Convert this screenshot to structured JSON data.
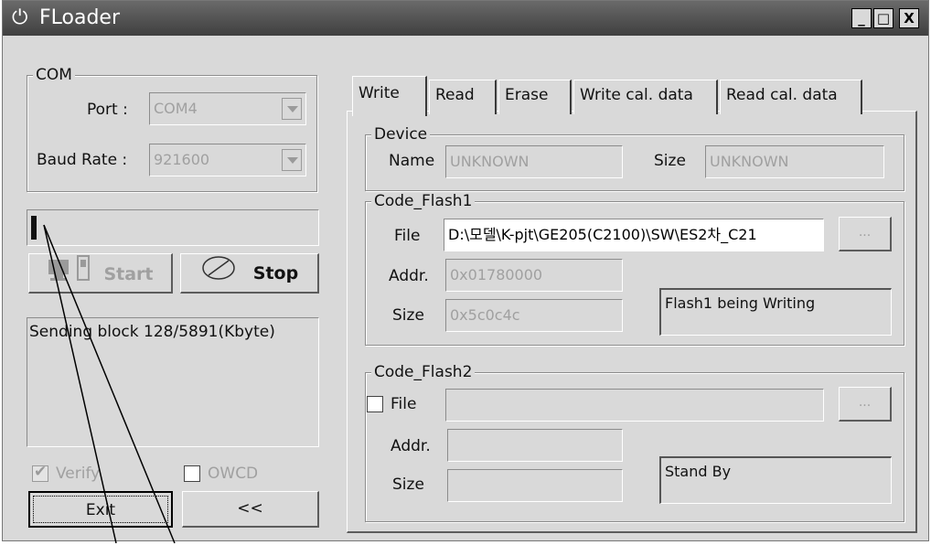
{
  "window": {
    "title": "FLoader",
    "icon": "power-icon",
    "min_label": "_",
    "max_label": "□",
    "close_label": "X"
  },
  "com": {
    "legend": "COM",
    "port_label": "Port :",
    "port_value": "COM4",
    "baud_label": "Baud Rate :",
    "baud_value": "921600"
  },
  "progress": {
    "value": 0.02
  },
  "buttons": {
    "start": "Start",
    "stop": "Stop",
    "exit": "Exit",
    "collapse": "<<",
    "browse": "..."
  },
  "log": {
    "text": "Sending block 128/5891(Kbyte)"
  },
  "options": {
    "verify_label": "Verify",
    "verify_checked": true,
    "owcd_label": "OWCD",
    "owcd_checked": false
  },
  "tabs": [
    {
      "label": "Write",
      "active": true
    },
    {
      "label": "Read"
    },
    {
      "label": "Erase"
    },
    {
      "label": "Write cal. data"
    },
    {
      "label": "Read cal. data"
    }
  ],
  "device": {
    "legend": "Device",
    "name_label": "Name",
    "name_value": "UNKNOWN",
    "size_label": "Size",
    "size_value": "UNKNOWN"
  },
  "flash1": {
    "legend": "Code_Flash1",
    "file_label": "File",
    "file_value": "D:\\모델\\K-pjt\\GE205(C2100)\\SW\\ES2차_C21",
    "addr_label": "Addr.",
    "addr_value": "0x01780000",
    "size_label": "Size",
    "size_value": "0x5c0c4c",
    "status": "Flash1 being Writing"
  },
  "flash2": {
    "legend": "Code_Flash2",
    "file_label": "File",
    "file_checked": false,
    "file_value": "",
    "addr_label": "Addr.",
    "addr_value": "",
    "size_label": "Size",
    "size_value": "",
    "status": "Stand By"
  }
}
